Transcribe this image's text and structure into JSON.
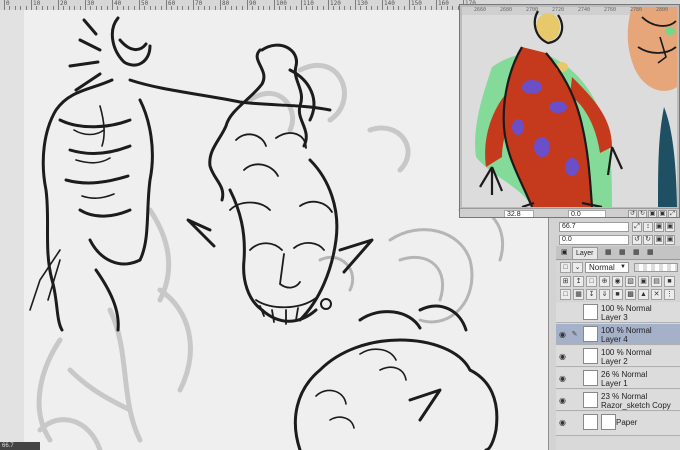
{
  "ruler": {
    "labels": [
      "0",
      "10",
      "20",
      "30",
      "40",
      "50",
      "60",
      "70",
      "80",
      "90",
      "100",
      "110",
      "120",
      "130",
      "140",
      "150",
      "160",
      "170"
    ]
  },
  "canvas": {
    "content": "sketch-page"
  },
  "navigator": {
    "ruler_labels": [
      "2660",
      "2680",
      "2700",
      "2720",
      "2740",
      "2760",
      "2780",
      "2800"
    ],
    "zoom_value": "32.8",
    "angle_value": "0.0",
    "buttons": [
      "↺",
      "↻",
      "▣",
      "▣",
      "⤢"
    ]
  },
  "properties": {
    "brush_size": "66.7",
    "rotation": "0.0",
    "buttons_row1": [
      "⤢",
      "↕",
      "▣",
      "▣"
    ],
    "buttons_row2": [
      "↺",
      "↻",
      "▣",
      "▣"
    ]
  },
  "layer_panel": {
    "tab_label": "Layer",
    "blend_mode": "Normal",
    "layers": [
      {
        "blend": "100 % Normal",
        "name": "Layer 3",
        "visible": false,
        "selected": false
      },
      {
        "blend": "100 % Normal",
        "name": "Layer 4",
        "visible": true,
        "selected": true
      },
      {
        "blend": "100 % Normal",
        "name": "Layer 2",
        "visible": true,
        "selected": false
      },
      {
        "blend": "26 % Normal",
        "name": "Layer 1",
        "visible": true,
        "selected": false
      },
      {
        "blend": "23 % Normal",
        "name": "Razor_sketch Copy",
        "visible": true,
        "selected": false
      }
    ],
    "paper_name": "Paper"
  },
  "colors": {
    "selected_layer": "#a5b1c8",
    "panel_bg": "#d3d3d3",
    "sketch_ink": "#1c1c1c",
    "figure_red": "#c8381c",
    "figure_glow": "#6fd88a",
    "figure_purple": "#6a4fc8"
  },
  "status": {
    "zoom": "66.7"
  }
}
